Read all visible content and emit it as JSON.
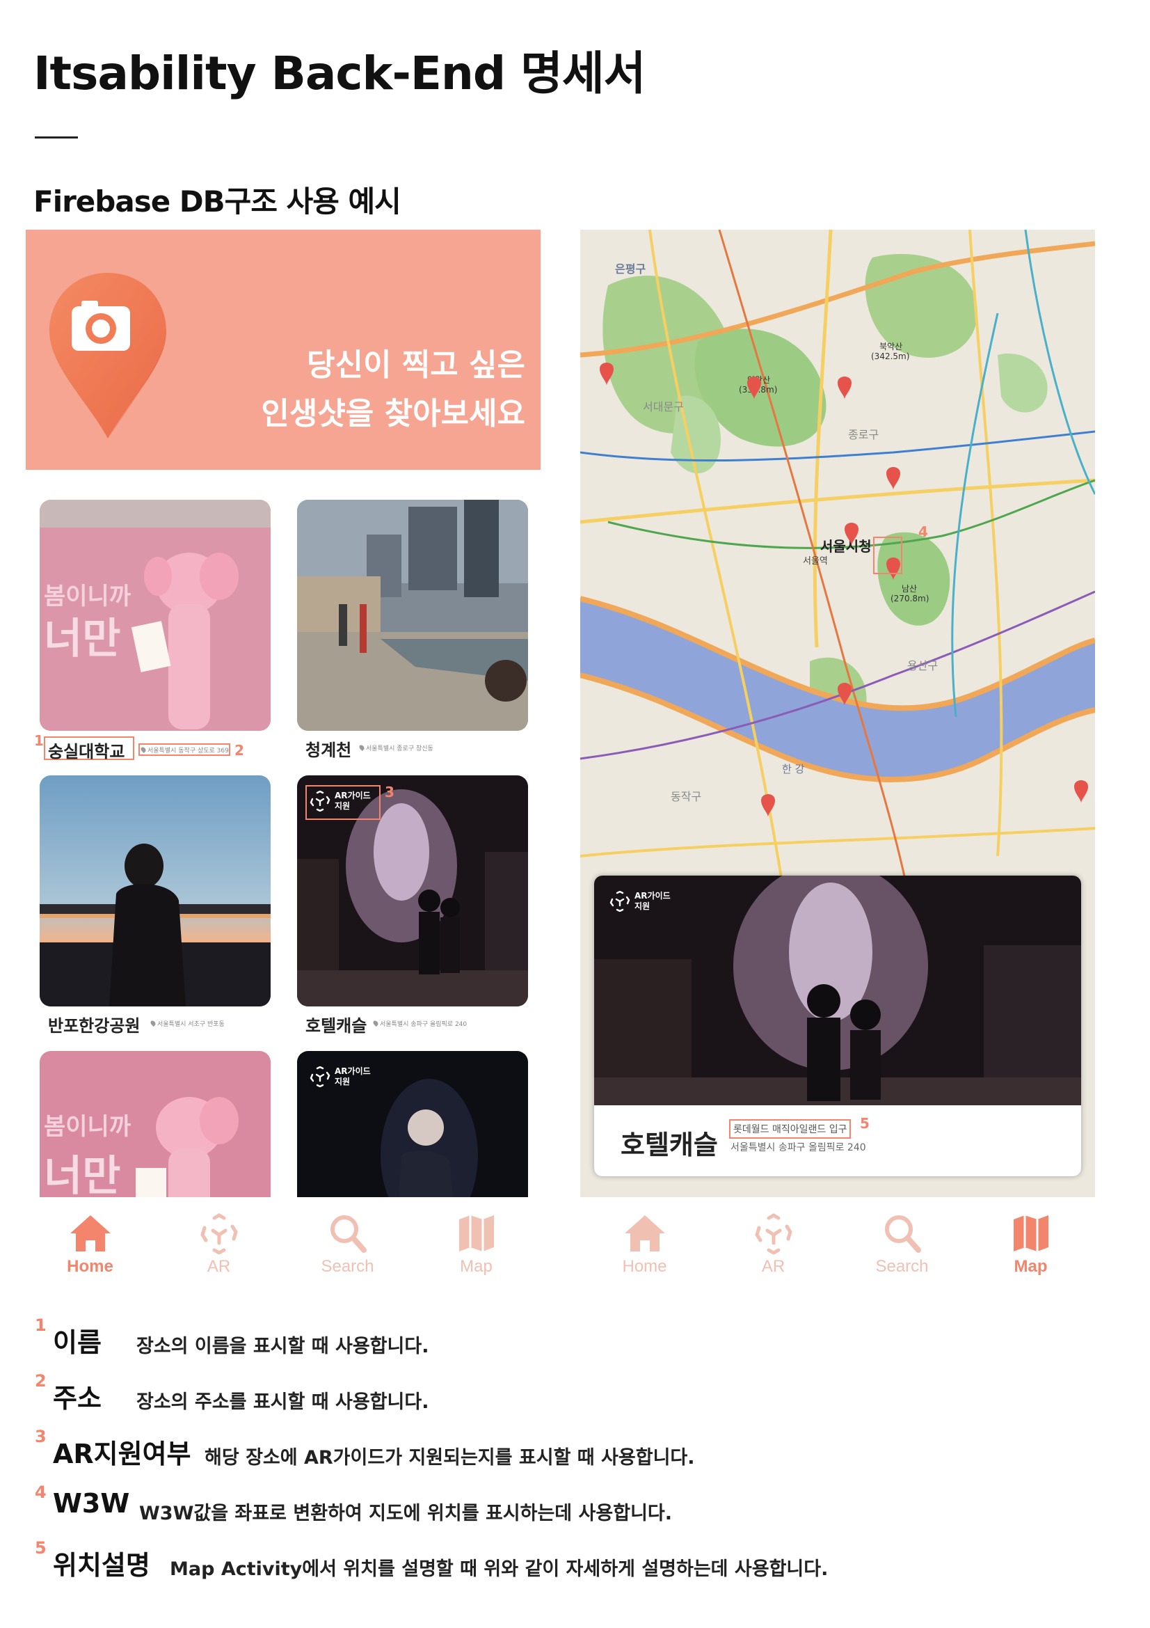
{
  "document": {
    "title": "Itsability Back-End 명세서",
    "section_title": "Firebase DB구조 사용 예시"
  },
  "app_list": {
    "banner_line1": "당신이 찍고 싶은",
    "banner_line2": "인생샷을 찾아보세요",
    "cards": [
      {
        "name": "숭실대학교",
        "address": "서울특별시 동작구 상도로 369"
      },
      {
        "name": "청계천",
        "address": "서울특별시 종로구 창신동"
      },
      {
        "name": "반포한강공원",
        "address": "서울특별시 서초구 반포동"
      },
      {
        "name": "호텔캐슬",
        "address": "서울특별시 송파구 올림픽로 240"
      }
    ],
    "ar_badge": "AR가이드 지원"
  },
  "annotations": {
    "n1": "1",
    "n2": "2",
    "n3": "3",
    "n4": "4",
    "n5": "5"
  },
  "nav": {
    "home": "Home",
    "ar": "AR",
    "search": "Search",
    "map": "Map",
    "left_active": "Home",
    "right_active": "Map"
  },
  "map": {
    "labels": {
      "eunpyeong": "은평구",
      "seodaemun": "서대문구",
      "seoul_station": "서울역",
      "city_hall": "서울시청",
      "namsan": "남산\n(270.8m)",
      "jongno": "종로구",
      "yongsan": "용산구",
      "hangang": "한강",
      "dongjak": "동작구",
      "bukhansan": "북악산\n(342.5m)",
      "inwangsan": "인왕산\n(339.8m)"
    },
    "card": {
      "name": "호텔캐슬",
      "description": "롯데월드 매직아일랜드 입구",
      "address": "서울특별시 송파구 올림픽로 240",
      "ar_badge": "AR가이드 지원"
    }
  },
  "legend": [
    {
      "num": "1",
      "term": "이름",
      "desc": "장소의 이름을 표시할 때 사용합니다."
    },
    {
      "num": "2",
      "term": "주소",
      "desc": "장소의 주소를 표시할 때 사용합니다."
    },
    {
      "num": "3",
      "term": "AR지원여부",
      "desc": "해당 장소에 AR가이드가 지원되는지를 표시할 때 사용합니다."
    },
    {
      "num": "4",
      "term": "W3W",
      "desc": "W3W값을 좌표로 변환하여 지도에 위치를 표시하는데 사용합니다."
    },
    {
      "num": "5",
      "term": "위치설명",
      "desc": "Map Activity에서 위치를 설명할 때 위와 같이 자세하게 설명하는데 사용합니다."
    }
  ],
  "colors": {
    "accent": "#f2856c",
    "banner": "#f6a593",
    "nav_inactive": "#f0c0b3"
  }
}
